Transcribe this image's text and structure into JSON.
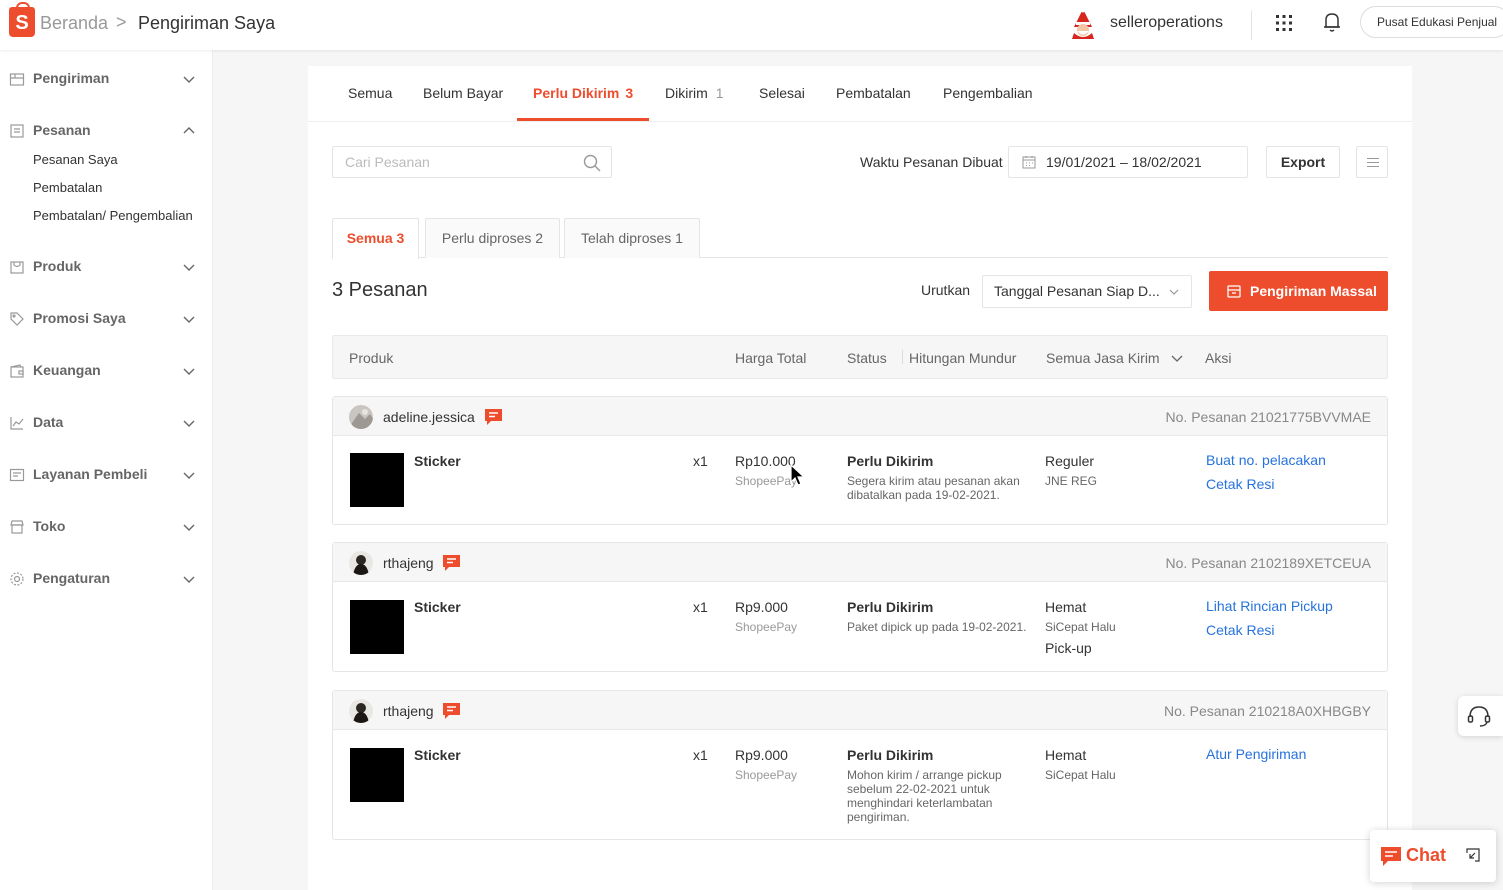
{
  "header": {
    "logo_letter": "S",
    "breadcrumb_home": "Beranda",
    "breadcrumb_sep": ">",
    "breadcrumb_current": "Pengiriman Saya",
    "shop_name": "selleroperations",
    "edu_button": "Pusat Edukasi Penjual",
    "icons": [
      "apps-grid-icon",
      "bell-icon"
    ]
  },
  "sidebar": {
    "groups": [
      {
        "label": "Pengiriman",
        "icon": "shipping-icon",
        "expanded": false
      },
      {
        "label": "Pesanan",
        "icon": "order-icon",
        "expanded": true,
        "items": [
          "Pesanan Saya",
          "Pembatalan",
          "Pembatalan/ Pengembalian"
        ]
      },
      {
        "label": "Produk",
        "icon": "product-icon",
        "expanded": false
      },
      {
        "label": "Promosi Saya",
        "icon": "tag-icon",
        "expanded": false
      },
      {
        "label": "Keuangan",
        "icon": "wallet-icon",
        "expanded": false
      },
      {
        "label": "Data",
        "icon": "chart-icon",
        "expanded": false
      },
      {
        "label": "Layanan Pembeli",
        "icon": "chat-box-icon",
        "expanded": false
      },
      {
        "label": "Toko",
        "icon": "shop-icon",
        "expanded": false
      },
      {
        "label": "Pengaturan",
        "icon": "gear-icon",
        "expanded": false
      }
    ]
  },
  "tabs": [
    {
      "label": "Semua"
    },
    {
      "label": "Belum Bayar"
    },
    {
      "label": "Perlu Dikirim",
      "count": "3",
      "active": true
    },
    {
      "label": "Dikirim",
      "count": "1"
    },
    {
      "label": "Selesai"
    },
    {
      "label": "Pembatalan"
    },
    {
      "label": "Pengembalian"
    }
  ],
  "filters": {
    "search_placeholder": "Cari Pesanan",
    "date_label": "Waktu Pesanan Dibuat",
    "date_range": "19/01/2021 – 18/02/2021",
    "export_label": "Export"
  },
  "subtabs": [
    {
      "label": "Semua 3",
      "active": true
    },
    {
      "label": "Perlu diproses 2"
    },
    {
      "label": "Telah diproses 1"
    }
  ],
  "list": {
    "count_title": "3 Pesanan",
    "sort_label": "Urutkan",
    "sort_value": "Tanggal Pesanan Siap D...",
    "mass_button": "Pengiriman Massal"
  },
  "table_headers": {
    "product": "Produk",
    "total": "Harga Total",
    "status": "Status",
    "countdown": "Hitungan Mundur",
    "courier": "Semua Jasa Kirim",
    "action": "Aksi"
  },
  "orders": [
    {
      "buyer": "adeline.jessica",
      "order_no": "No. Pesanan 21021775BVVMAE",
      "product": "Sticker",
      "qty": "x1",
      "price": "Rp10.000",
      "payment": "ShopeePay",
      "status": "Perlu Dikirim",
      "status_desc": "Segera kirim atau pesanan akan dibatalkan pada 19-02-2021.",
      "ship": "Reguler",
      "ship_desc": "JNE REG",
      "ship_extra": "",
      "actions": [
        "Buat no. pelacakan",
        "Cetak Resi"
      ]
    },
    {
      "buyer": "rthajeng",
      "order_no": "No. Pesanan 2102189XETCEUA",
      "product": "Sticker",
      "qty": "x1",
      "price": "Rp9.000",
      "payment": "ShopeePay",
      "status": "Perlu Dikirim",
      "status_desc": "Paket dipick up pada 19-02-2021.",
      "ship": "Hemat",
      "ship_desc": "SiCepat Halu",
      "ship_extra": "Pick-up",
      "actions": [
        "Lihat Rincian Pickup",
        "Cetak Resi"
      ]
    },
    {
      "buyer": "rthajeng",
      "order_no": "No. Pesanan 210218A0XHBGBY",
      "product": "Sticker",
      "qty": "x1",
      "price": "Rp9.000",
      "payment": "ShopeePay",
      "status": "Perlu Dikirim",
      "status_desc": "Mohon kirim / arrange pickup sebelum 22-02-2021 untuk menghindari keterlambatan pengiriman.",
      "ship": "Hemat",
      "ship_desc": "SiCepat Halu",
      "ship_extra": "",
      "actions": [
        "Atur Pengiriman"
      ]
    }
  ],
  "floating": {
    "chat_label": "Chat"
  },
  "colors": {
    "brand": "#ee4d2d",
    "link": "#2673dd"
  }
}
